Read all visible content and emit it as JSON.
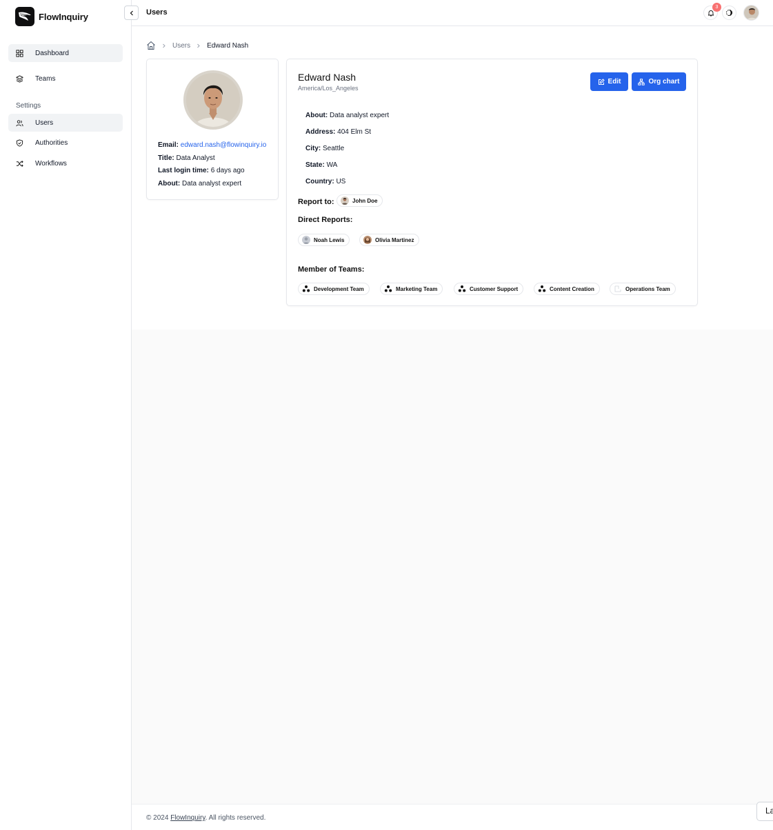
{
  "app": {
    "name": "FlowInquiry"
  },
  "sidebar": {
    "items": [
      {
        "label": "Dashboard",
        "icon": "grid-icon"
      },
      {
        "label": "Teams",
        "icon": "layers-icon"
      }
    ],
    "settings_label": "Settings",
    "settings_items": [
      {
        "label": "Users",
        "icon": "users-icon"
      },
      {
        "label": "Authorities",
        "icon": "shield-icon"
      },
      {
        "label": "Workflows",
        "icon": "shuffle-icon"
      }
    ]
  },
  "header": {
    "title": "Users",
    "notification_count": "3"
  },
  "breadcrumb": {
    "parent": "Users",
    "current": "Edward Nash"
  },
  "profile": {
    "email_label": "Email:",
    "email": "edward.nash@flowinquiry.io",
    "title_label": "Title:",
    "title": "Data Analyst",
    "last_login_label": "Last login time:",
    "last_login": "6 days ago",
    "about_label": "About:",
    "about": "Data analyst expert"
  },
  "detail": {
    "name": "Edward Nash",
    "timezone": "America/Los_Angeles",
    "edit_label": "Edit",
    "org_chart_label": "Org chart",
    "fields": [
      {
        "label": "About:",
        "value": "Data analyst expert"
      },
      {
        "label": "Address:",
        "value": "404 Elm St"
      },
      {
        "label": "City:",
        "value": "Seattle"
      },
      {
        "label": "State:",
        "value": "WA"
      },
      {
        "label": "Country:",
        "value": "US"
      }
    ],
    "report_to_label": "Report to:",
    "report_to": "John Doe",
    "direct_reports_label": "Direct Reports:",
    "direct_reports": [
      "Noah Lewis",
      "Olivia Martinez"
    ],
    "teams_label": "Member of Teams:",
    "teams": [
      "Development Team",
      "Marketing Team",
      "Customer Support",
      "Content Creation",
      "Operations Team"
    ]
  },
  "footer": {
    "copyright": "© 2024",
    "brand": "FlowInquiry",
    "rights": ". All rights reserved.",
    "lang_button": "La"
  },
  "colors": {
    "primary": "#2563eb",
    "badge": "#f87171",
    "active_nav": "#f1f3f5"
  }
}
